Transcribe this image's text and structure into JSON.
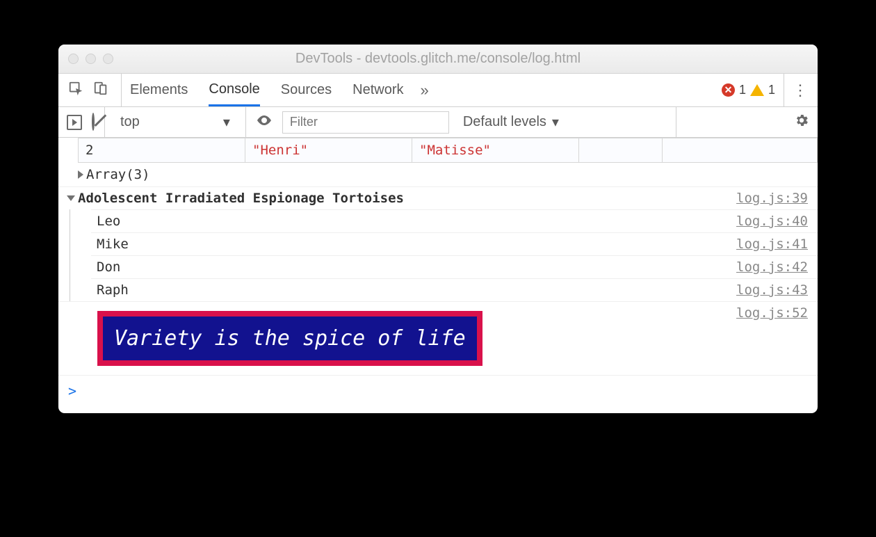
{
  "window": {
    "title": "DevTools - devtools.glitch.me/console/log.html"
  },
  "tabs": {
    "elements": "Elements",
    "console": "Console",
    "sources": "Sources",
    "network": "Network",
    "more": "»"
  },
  "status": {
    "errors": "1",
    "warnings": "1"
  },
  "toolbar": {
    "context": "top",
    "filter_placeholder": "Filter",
    "levels": "Default levels"
  },
  "table": {
    "index": "2",
    "first": "\"Henri\"",
    "last": "\"Matisse\""
  },
  "array_line": "Array(3)",
  "group": {
    "title": "Adolescent Irradiated Espionage Tortoises",
    "src": "log.js:39",
    "items": [
      {
        "msg": "Leo",
        "src": "log.js:40"
      },
      {
        "msg": "Mike",
        "src": "log.js:41"
      },
      {
        "msg": "Don",
        "src": "log.js:42"
      },
      {
        "msg": "Raph",
        "src": "log.js:43"
      }
    ]
  },
  "styled": {
    "msg": "Variety is the spice of life",
    "src": "log.js:52"
  },
  "prompt": ">"
}
